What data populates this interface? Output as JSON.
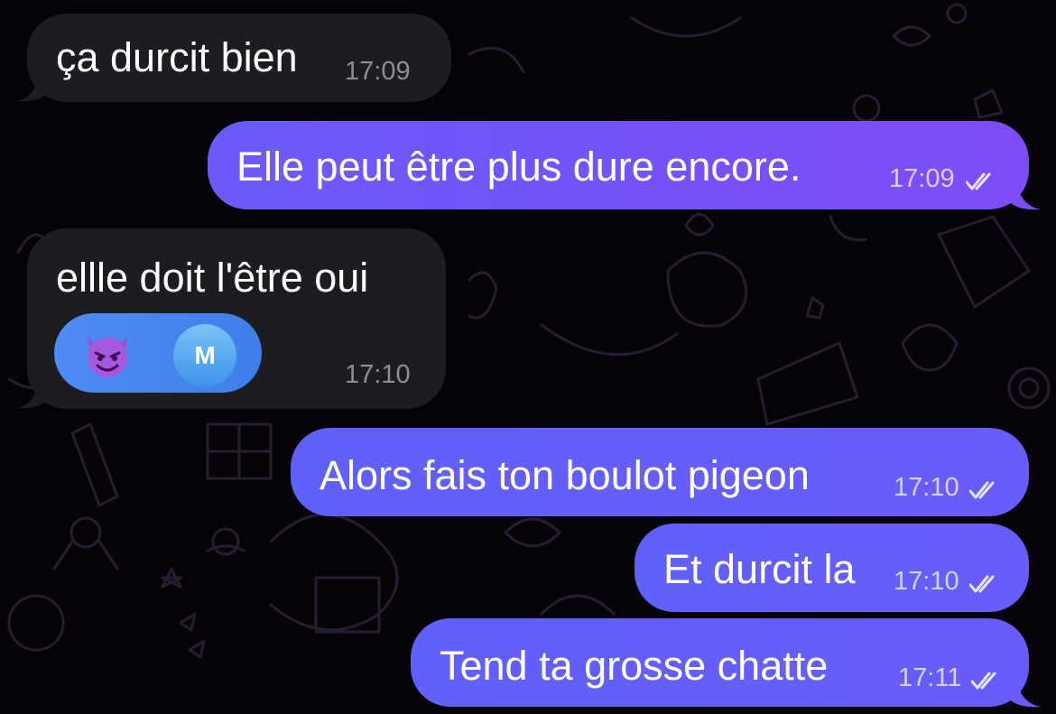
{
  "chat": {
    "messages": [
      {
        "direction": "incoming",
        "text": "ça durcit bien",
        "time": "17:09"
      },
      {
        "direction": "outgoing",
        "text": "Elle peut être plus dure encore.",
        "time": "17:09",
        "status": "read"
      },
      {
        "direction": "incoming",
        "text": "ellle doit l'être oui",
        "time": "17:10",
        "reaction": {
          "emoji": "smiling-face-with-horns",
          "avatar_initial": "M"
        }
      },
      {
        "direction": "outgoing",
        "text": "Alors fais ton boulot pigeon",
        "time": "17:10",
        "status": "read"
      },
      {
        "direction": "outgoing",
        "text": "Et durcit la",
        "time": "17:10",
        "status": "read"
      },
      {
        "direction": "outgoing",
        "text": "Tend ta grosse chatte",
        "time": "17:11",
        "status": "read"
      }
    ]
  },
  "colors": {
    "background": "#050307",
    "incoming_bubble": "#1c1c21",
    "outgoing_bubble": "#6b5bfb",
    "reaction_pill": "#4f8cf5"
  },
  "icons": [
    "chat-doodle-wallpaper",
    "double-check-icon",
    "smiling-face-with-horns-emoji",
    "avatar"
  ]
}
